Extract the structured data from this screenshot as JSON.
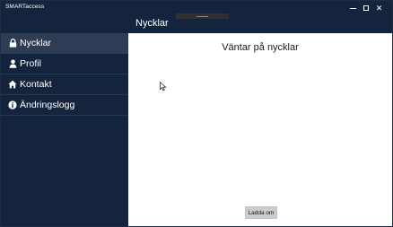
{
  "app": {
    "title": "SMARTaccess"
  },
  "window_controls": {
    "minimize_icon": "minimize-icon",
    "maximize_icon": "maximize-icon",
    "close_icon": "close-icon",
    "close_glyph": "✕"
  },
  "sidebar": {
    "items": [
      {
        "label": "Nycklar",
        "icon": "lock-icon",
        "active": true
      },
      {
        "label": "Profil",
        "icon": "person-icon",
        "active": false
      },
      {
        "label": "Kontakt",
        "icon": "home-icon",
        "active": false
      },
      {
        "label": "Ändringslogg",
        "icon": "info-icon",
        "active": false
      }
    ]
  },
  "header": {
    "title": "Nycklar"
  },
  "main": {
    "status_text": "Väntar på nycklar",
    "reload_label": "Ladda om"
  },
  "colors": {
    "sidebar_bg": "#14243d",
    "active_item_bg": "#2e3d55",
    "content_bg": "#ffffff",
    "button_bg": "#cccccc"
  }
}
